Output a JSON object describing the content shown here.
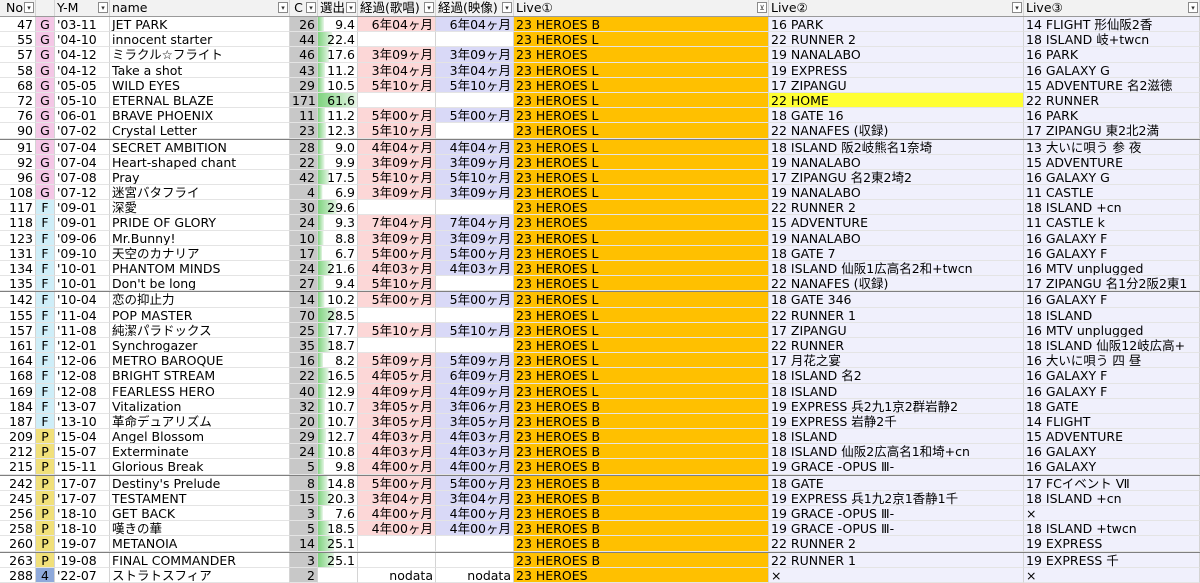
{
  "headers": {
    "no": "No",
    "cat": "",
    "ym": "Y-M",
    "name": "name",
    "cnt": "C",
    "pct": "選出",
    "el1": "経過(歌唱)",
    "el2": "経過(映像)",
    "live1": "Live①",
    "live2": "Live②",
    "live3": "Live③"
  },
  "colors": {
    "G": "#f4c7e6",
    "F": "#cfeef8",
    "P": "#f1e07a",
    "4": "#8ea9db",
    "live1": "#ffc000",
    "highlight": "#ffff33",
    "pct_bar": "#7fd37f",
    "el1_bg": "#fcd7d7",
    "el2_bg": "#d9d9f7"
  },
  "rows": [
    {
      "no": "47",
      "cat": "G",
      "ym": "'03-11",
      "name": "JET PARK",
      "cnt": "26",
      "pct": "9.4",
      "el1": "6年04ヶ月",
      "el2": "6年04ヶ月",
      "live1": "23 HEROES B",
      "live2": "16 PARK",
      "live3": "14 FLIGHT 形仙阪2香"
    },
    {
      "no": "55",
      "cat": "G",
      "ym": "'04-10",
      "name": "innocent starter",
      "cnt": "44",
      "pct": "22.4",
      "el1": "",
      "el2": "",
      "live1": "23 HEROES L",
      "live2": "22 RUNNER 2",
      "live3": "18 ISLAND 岐+twcn"
    },
    {
      "no": "57",
      "cat": "G",
      "ym": "'04-12",
      "name": "ミラクル☆フライト",
      "cnt": "46",
      "pct": "17.6",
      "el1": "3年09ヶ月",
      "el2": "3年09ヶ月",
      "live1": "23 HEROES",
      "live2": "19 NANALABO",
      "live3": "16 PARK"
    },
    {
      "no": "58",
      "cat": "G",
      "ym": "'04-12",
      "name": "Take a shot",
      "cnt": "43",
      "pct": "11.2",
      "el1": "3年04ヶ月",
      "el2": "3年04ヶ月",
      "live1": "23 HEROES L",
      "live2": "19 EXPRESS",
      "live3": "16 GALAXY G"
    },
    {
      "no": "68",
      "cat": "G",
      "ym": "'05-05",
      "name": "WILD EYES",
      "cnt": "29",
      "pct": "10.5",
      "el1": "5年10ヶ月",
      "el2": "5年10ヶ月",
      "live1": "23 HEROES L",
      "live2": "17 ZIPANGU",
      "live3": "15 ADVENTURE 名2滋徳"
    },
    {
      "no": "72",
      "cat": "G",
      "ym": "'05-10",
      "name": "ETERNAL BLAZE",
      "cnt": "171",
      "pct": "61.6",
      "el1": "",
      "el2": "",
      "live1": "23 HEROES L",
      "live2": "22 HOME",
      "live3": "22 RUNNER",
      "hl": true
    },
    {
      "no": "76",
      "cat": "G",
      "ym": "'06-01",
      "name": "BRAVE PHOENIX",
      "cnt": "11",
      "pct": "11.2",
      "el1": "5年00ヶ月",
      "el2": "5年00ヶ月",
      "live1": "23 HEROES L",
      "live2": "18 GATE 16",
      "live3": "16 PARK"
    },
    {
      "no": "90",
      "cat": "G",
      "ym": "'07-02",
      "name": "Crystal Letter",
      "cnt": "23",
      "pct": "12.3",
      "el1": "5年10ヶ月",
      "el2": "",
      "live1": "23 HEROES L",
      "live2": "22 NANAFES (収録)",
      "live3": "17 ZIPANGU 東2北2満"
    },
    {
      "no": "91",
      "cat": "G",
      "ym": "'07-04",
      "name": "SECRET AMBITION",
      "cnt": "28",
      "pct": "9.0",
      "el1": "4年04ヶ月",
      "el2": "4年04ヶ月",
      "live1": "23 HEROES L",
      "live2": "18 ISLAND 阪2岐熊名1奈埼",
      "live3": "13 大いに唄う 参 夜",
      "sep": true
    },
    {
      "no": "92",
      "cat": "G",
      "ym": "'07-04",
      "name": "Heart-shaped chant",
      "cnt": "22",
      "pct": "9.9",
      "el1": "3年09ヶ月",
      "el2": "3年09ヶ月",
      "live1": "23 HEROES L",
      "live2": "19 NANALABO",
      "live3": "15 ADVENTURE"
    },
    {
      "no": "96",
      "cat": "G",
      "ym": "'07-08",
      "name": "Pray",
      "cnt": "42",
      "pct": "17.5",
      "el1": "5年10ヶ月",
      "el2": "5年10ヶ月",
      "live1": "23 HEROES L",
      "live2": "17 ZIPANGU 名2東2埼2",
      "live3": "16 GALAXY G"
    },
    {
      "no": "108",
      "cat": "G",
      "ym": "'07-12",
      "name": "迷宮バタフライ",
      "cnt": "4",
      "pct": "6.9",
      "el1": "3年09ヶ月",
      "el2": "3年09ヶ月",
      "live1": "23 HEROES L",
      "live2": "19 NANALABO",
      "live3": "11 CASTLE"
    },
    {
      "no": "117",
      "cat": "F",
      "ym": "'09-01",
      "name": "深愛",
      "cnt": "30",
      "pct": "29.6",
      "el1": "",
      "el2": "",
      "live1": "23 HEROES",
      "live2": "22 RUNNER 2",
      "live3": "18 ISLAND +cn"
    },
    {
      "no": "118",
      "cat": "F",
      "ym": "'09-01",
      "name": "PRIDE OF GLORY",
      "cnt": "24",
      "pct": "9.3",
      "el1": "7年04ヶ月",
      "el2": "7年04ヶ月",
      "live1": "23 HEROES",
      "live2": "15 ADVENTURE",
      "live3": "11 CASTLE k"
    },
    {
      "no": "123",
      "cat": "F",
      "ym": "'09-06",
      "name": "Mr.Bunny!",
      "cnt": "10",
      "pct": "8.8",
      "el1": "3年09ヶ月",
      "el2": "3年09ヶ月",
      "live1": "23 HEROES L",
      "live2": "19 NANALABO",
      "live3": "16 GALAXY F"
    },
    {
      "no": "131",
      "cat": "F",
      "ym": "'09-10",
      "name": "天空のカナリア",
      "cnt": "17",
      "pct": "6.7",
      "el1": "5年00ヶ月",
      "el2": "5年00ヶ月",
      "live1": "23 HEROES L",
      "live2": "18 GATE 7",
      "live3": "16 GALAXY F"
    },
    {
      "no": "134",
      "cat": "F",
      "ym": "'10-01",
      "name": "PHANTOM MINDS",
      "cnt": "24",
      "pct": "21.6",
      "el1": "4年03ヶ月",
      "el2": "4年03ヶ月",
      "live1": "23 HEROES L",
      "live2": "18 ISLAND 仙阪1広高名2和+twcn",
      "live3": "16 MTV unplugged"
    },
    {
      "no": "135",
      "cat": "F",
      "ym": "'10-01",
      "name": "Don't be long",
      "cnt": "27",
      "pct": "9.4",
      "el1": "5年10ヶ月",
      "el2": "",
      "live1": "23 HEROES L",
      "live2": "22 NANAFES (収録)",
      "live3": "17 ZIPANGU 名1分2阪2東1"
    },
    {
      "no": "142",
      "cat": "F",
      "ym": "'10-04",
      "name": "恋の抑止力",
      "cnt": "14",
      "pct": "10.2",
      "el1": "5年00ヶ月",
      "el2": "5年00ヶ月",
      "live1": "23 HEROES L",
      "live2": "18 GATE 346",
      "live3": "16 GALAXY F",
      "sep": true
    },
    {
      "no": "155",
      "cat": "F",
      "ym": "'11-04",
      "name": "POP MASTER",
      "cnt": "70",
      "pct": "28.5",
      "el1": "",
      "el2": "",
      "live1": "23 HEROES L",
      "live2": "22 RUNNER 1",
      "live3": "18 ISLAND"
    },
    {
      "no": "157",
      "cat": "F",
      "ym": "'11-08",
      "name": "純潔パラドックス",
      "cnt": "25",
      "pct": "17.7",
      "el1": "5年10ヶ月",
      "el2": "5年10ヶ月",
      "live1": "23 HEROES L",
      "live2": "17 ZIPANGU",
      "live3": "16 MTV unplugged"
    },
    {
      "no": "161",
      "cat": "F",
      "ym": "'12-01",
      "name": "Synchrogazer",
      "cnt": "35",
      "pct": "18.7",
      "el1": "",
      "el2": "",
      "live1": "23 HEROES L",
      "live2": "22 RUNNER",
      "live3": "18 ISLAND 仙阪12岐広高+"
    },
    {
      "no": "164",
      "cat": "F",
      "ym": "'12-06",
      "name": "METRO BAROQUE",
      "cnt": "16",
      "pct": "8.2",
      "el1": "5年09ヶ月",
      "el2": "5年09ヶ月",
      "live1": "23 HEROES L",
      "live2": "17 月花之宴",
      "live3": "16 大いに唄う 四 昼"
    },
    {
      "no": "168",
      "cat": "F",
      "ym": "'12-08",
      "name": "BRIGHT STREAM",
      "cnt": "22",
      "pct": "16.5",
      "el1": "4年05ヶ月",
      "el2": "6年09ヶ月",
      "live1": "23 HEROES L",
      "live2": "18 ISLAND 名2",
      "live3": "16 GALAXY F"
    },
    {
      "no": "169",
      "cat": "F",
      "ym": "'12-08",
      "name": "FEARLESS HERO",
      "cnt": "40",
      "pct": "12.9",
      "el1": "4年09ヶ月",
      "el2": "4年09ヶ月",
      "live1": "23 HEROES L",
      "live2": "18 ISLAND",
      "live3": "16 GALAXY F"
    },
    {
      "no": "184",
      "cat": "F",
      "ym": "'13-07",
      "name": "Vitalization",
      "cnt": "32",
      "pct": "10.7",
      "el1": "3年05ヶ月",
      "el2": "3年06ヶ月",
      "live1": "23 HEROES B",
      "live2": "19 EXPRESS 兵2九1京2群岩静2",
      "live3": "18 GATE"
    },
    {
      "no": "187",
      "cat": "F",
      "ym": "'13-10",
      "name": "革命デュアリズム",
      "cnt": "20",
      "pct": "10.7",
      "el1": "3年05ヶ月",
      "el2": "3年05ヶ月",
      "live1": "23 HEROES B",
      "live2": "19 EXPRESS 岩静2千",
      "live3": "14 FLIGHT"
    },
    {
      "no": "209",
      "cat": "P",
      "ym": "'15-04",
      "name": "Angel Blossom",
      "cnt": "29",
      "pct": "12.7",
      "el1": "4年03ヶ月",
      "el2": "4年03ヶ月",
      "live1": "23 HEROES B",
      "live2": "18 ISLAND",
      "live3": "15 ADVENTURE"
    },
    {
      "no": "212",
      "cat": "P",
      "ym": "'15-07",
      "name": "Exterminate",
      "cnt": "24",
      "pct": "10.8",
      "el1": "4年03ヶ月",
      "el2": "4年03ヶ月",
      "live1": "23 HEROES B",
      "live2": "18 ISLAND 仙阪2広高名1和埼+cn",
      "live3": "16 GALAXY"
    },
    {
      "no": "215",
      "cat": "P",
      "ym": "'15-11",
      "name": "Glorious Break",
      "cnt": "5",
      "pct": "9.8",
      "el1": "4年00ヶ月",
      "el2": "4年00ヶ月",
      "live1": "23 HEROES B",
      "live2": "19 GRACE -OPUS Ⅲ-",
      "live3": "16 GALAXY"
    },
    {
      "no": "242",
      "cat": "P",
      "ym": "'17-07",
      "name": "Destiny's Prelude",
      "cnt": "8",
      "pct": "14.8",
      "el1": "5年00ヶ月",
      "el2": "5年00ヶ月",
      "live1": "23 HEROES B",
      "live2": "18 GATE",
      "live3": "17 FCイベント Ⅶ",
      "sep": true
    },
    {
      "no": "245",
      "cat": "P",
      "ym": "'17-07",
      "name": "TESTAMENT",
      "cnt": "15",
      "pct": "20.3",
      "el1": "3年04ヶ月",
      "el2": "3年04ヶ月",
      "live1": "23 HEROES B",
      "live2": "19 EXPRESS 兵1九2京1香静1千",
      "live3": "18 ISLAND +cn"
    },
    {
      "no": "256",
      "cat": "P",
      "ym": "'18-10",
      "name": "GET BACK",
      "cnt": "3",
      "pct": "7.6",
      "el1": "4年00ヶ月",
      "el2": "4年00ヶ月",
      "live1": "23 HEROES B",
      "live2": "19 GRACE -OPUS Ⅲ-",
      "live3": "×"
    },
    {
      "no": "258",
      "cat": "P",
      "ym": "'18-10",
      "name": "嘆きの華",
      "cnt": "5",
      "pct": "18.5",
      "el1": "4年00ヶ月",
      "el2": "4年00ヶ月",
      "live1": "23 HEROES B",
      "live2": "19 GRACE -OPUS Ⅲ-",
      "live3": "18 ISLAND +twcn"
    },
    {
      "no": "260",
      "cat": "P",
      "ym": "'19-07",
      "name": "METANOIA",
      "cnt": "14",
      "pct": "25.1",
      "el1": "",
      "el2": "",
      "live1": "23 HEROES B",
      "live2": "22 RUNNER 2",
      "live3": "19 EXPRESS"
    },
    {
      "no": "263",
      "cat": "P",
      "ym": "'19-08",
      "name": "FINAL COMMANDER",
      "cnt": "3",
      "pct": "25.1",
      "el1": "",
      "el2": "",
      "live1": "23 HEROES B",
      "live2": "22 RUNNER 1",
      "live3": "19 EXPRESS 千",
      "sep": true
    },
    {
      "no": "288",
      "cat": "4",
      "ym": "'22-07",
      "name": "ストラトスフィア",
      "cnt": "2",
      "pct": "",
      "el1": "nodata",
      "el2": "nodata",
      "live1": "23 HEROES",
      "live2": "×",
      "live3": "×"
    }
  ]
}
